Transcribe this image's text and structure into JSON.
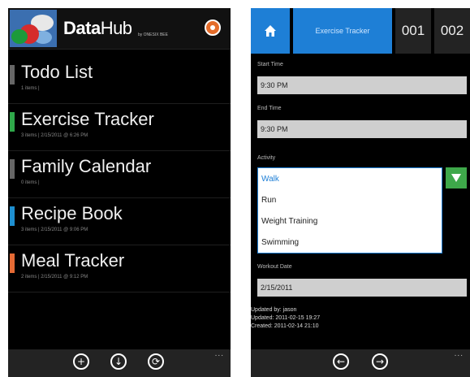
{
  "left": {
    "brand": {
      "name_bold": "Data",
      "name_light": "Hub",
      "subtitle": "by ONESIX BEE"
    },
    "items": [
      {
        "title": "Todo List",
        "sub": "1 items  |",
        "color": "#666666"
      },
      {
        "title": "Exercise Tracker",
        "sub": "3 items  |  2/15/2011 @ 6:26 PM",
        "color": "#2fa84a"
      },
      {
        "title": "Family Calendar",
        "sub": "0 items  |",
        "color": "#666666"
      },
      {
        "title": "Recipe Book",
        "sub": "3 items  |  2/15/2011 @ 9:06 PM",
        "color": "#1e8fd0"
      },
      {
        "title": "Meal Tracker",
        "sub": "2 items  |  2/15/2011 @ 9:12 PM",
        "color": "#e56a34"
      }
    ],
    "appbar": {
      "add": "+",
      "download": "↓",
      "sync": "⟳",
      "more": "..."
    }
  },
  "right": {
    "tabs": {
      "active": "Exercise Tracker",
      "t1": "001",
      "t2": "002"
    },
    "fields": {
      "start_label": "Start Time",
      "start_value": "9:30 PM",
      "end_label": "End Time",
      "end_value": "9:30 PM",
      "activity_label": "Activity",
      "options": [
        "Walk",
        "Run",
        "Weight Training",
        "Swimming"
      ],
      "date_label": "Workout Date",
      "date_value": "2/15/2011"
    },
    "meta": {
      "updated_by": "Updated by: jason",
      "updated": "Updated: 2011-02-15 19:27",
      "created": "Created: 2011-02-14 21:10"
    },
    "appbar": {
      "back": "←",
      "forward": "→",
      "more": "..."
    }
  },
  "colors": {
    "accent": "#1e7fd6",
    "green": "#3ea84a"
  }
}
